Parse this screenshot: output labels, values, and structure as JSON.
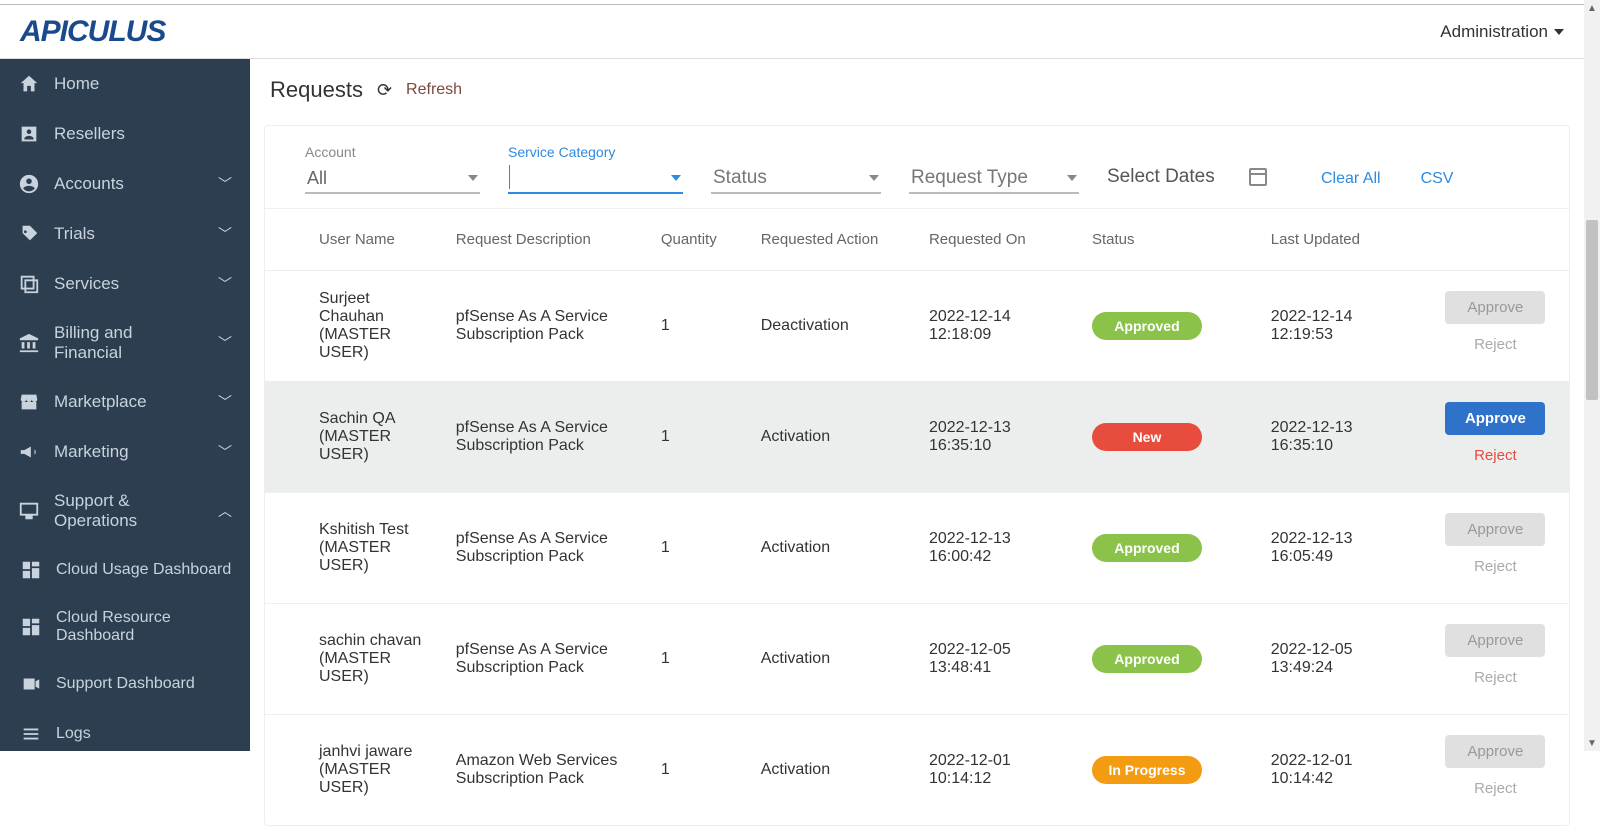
{
  "brand": "APICULUS",
  "header": {
    "admin_label": "Administration"
  },
  "sidebar": {
    "items": [
      {
        "label": "Home",
        "icon": "home",
        "expandable": false
      },
      {
        "label": "Resellers",
        "icon": "person-box",
        "expandable": false
      },
      {
        "label": "Accounts",
        "icon": "user-circle",
        "expandable": true,
        "chev": "down"
      },
      {
        "label": "Trials",
        "icon": "tag",
        "expandable": true,
        "chev": "down"
      },
      {
        "label": "Services",
        "icon": "layers",
        "expandable": true,
        "chev": "down"
      },
      {
        "label": "Billing and Financial",
        "icon": "bank",
        "expandable": true,
        "chev": "down"
      },
      {
        "label": "Marketplace",
        "icon": "store",
        "expandable": true,
        "chev": "down"
      },
      {
        "label": "Marketing",
        "icon": "megaphone",
        "expandable": true,
        "chev": "down"
      },
      {
        "label": "Support & Operations",
        "icon": "monitor",
        "expandable": true,
        "chev": "up"
      }
    ],
    "subitems": [
      {
        "label": "Cloud Usage Dashboard",
        "icon": "dashboard"
      },
      {
        "label": "Cloud Resource Dashboard",
        "icon": "dashboard"
      },
      {
        "label": "Support Dashboard",
        "icon": "video"
      },
      {
        "label": "Logs",
        "icon": "lines"
      }
    ]
  },
  "page": {
    "title": "Requests",
    "refresh_label": "Refresh"
  },
  "filters": {
    "account_label": "Account",
    "account_value": "All",
    "service_category_label": "Service Category",
    "status_label": "Status",
    "request_type_label": "Request Type",
    "select_dates_label": "Select Dates",
    "clear_all": "Clear All",
    "csv": "CSV"
  },
  "table": {
    "headers": [
      "User Name",
      "Request Description",
      "Quantity",
      "Requested Action",
      "Requested On",
      "Status",
      "Last Updated"
    ],
    "approve_label": "Approve",
    "reject_label": "Reject",
    "rows": [
      {
        "user": "Surjeet Chauhan (MASTER USER)",
        "desc": "pfSense As A Service Subscription Pack",
        "qty": "1",
        "action": "Deactivation",
        "requested_on": "2022-12-14 12:18:09",
        "status": "Approved",
        "status_class": "approved",
        "last_updated": "2022-12-14 12:19:53",
        "active": false
      },
      {
        "user": "Sachin QA (MASTER USER)",
        "desc": "pfSense As A Service Subscription Pack",
        "qty": "1",
        "action": "Activation",
        "requested_on": "2022-12-13 16:35:10",
        "status": "New",
        "status_class": "new",
        "last_updated": "2022-12-13 16:35:10",
        "active": true
      },
      {
        "user": "Kshitish Test (MASTER USER)",
        "desc": "pfSense As A Service Subscription Pack",
        "qty": "1",
        "action": "Activation",
        "requested_on": "2022-12-13 16:00:42",
        "status": "Approved",
        "status_class": "approved",
        "last_updated": "2022-12-13 16:05:49",
        "active": false
      },
      {
        "user": "sachin chavan (MASTER USER)",
        "desc": "pfSense As A Service Subscription Pack",
        "qty": "1",
        "action": "Activation",
        "requested_on": "2022-12-05 13:48:41",
        "status": "Approved",
        "status_class": "approved",
        "last_updated": "2022-12-05 13:49:24",
        "active": false
      },
      {
        "user": "janhvi jaware (MASTER USER)",
        "desc": "Amazon Web Services Subscription Pack",
        "qty": "1",
        "action": "Activation",
        "requested_on": "2022-12-01 10:14:12",
        "status": "In Progress",
        "status_class": "inprogress",
        "last_updated": "2022-12-01 10:14:42",
        "active": false
      }
    ]
  }
}
